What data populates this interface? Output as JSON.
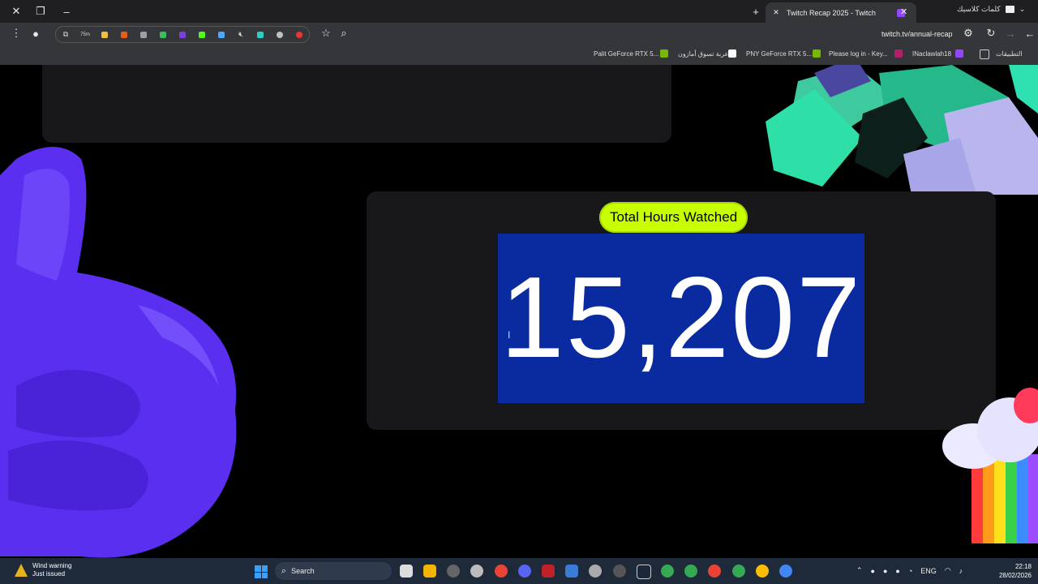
{
  "browser": {
    "active_tab_title": "Twitch Recap 2025 - Twitch",
    "other_tab_title": "كلمات كلاسيك",
    "url": "twitch.tv/annual-recap",
    "extension_badge": "75m"
  },
  "bookmarks": [
    {
      "label": "Palit GeForce RTX 5...",
      "icon": "nvidia-icon"
    },
    {
      "label": "عربة تسوق أمازون",
      "icon": "amazon-icon"
    },
    {
      "label": "PNY GeForce RTX 5...",
      "icon": "nvidia-icon"
    },
    {
      "label": "Please log in - Key...",
      "icon": "key-icon"
    },
    {
      "label": "INaclawlah18",
      "icon": "kick-icon"
    },
    {
      "label": "التطبيقات",
      "icon": "apps-grid-icon"
    }
  ],
  "recap": {
    "stat_label": "Total Hours Watched",
    "stat_value": "15,207",
    "label_color": "#c8ff00",
    "selection_color": "#0a2aa0"
  },
  "taskbar": {
    "weather_title": "Wind warning",
    "weather_sub": "Just issued",
    "search_placeholder": "Search",
    "language": "ENG",
    "time": "22:18",
    "date": "28/02/2026"
  }
}
